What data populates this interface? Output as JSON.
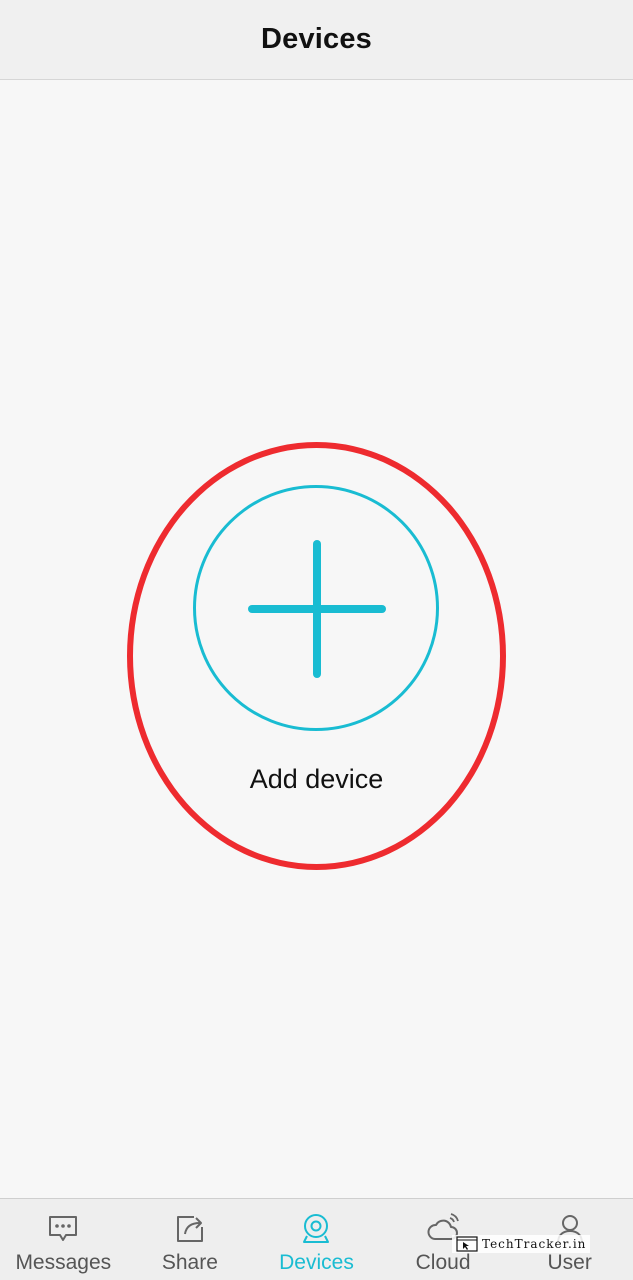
{
  "header": {
    "title": "Devices"
  },
  "main": {
    "add_device_label": "Add device",
    "add_icon": "plus-icon",
    "accent_color": "#19bcd2",
    "highlight_color": "#ee2b2f"
  },
  "tabbar": {
    "active": "Devices",
    "tabs": [
      {
        "label": "Messages",
        "icon": "message-icon"
      },
      {
        "label": "Share",
        "icon": "share-icon"
      },
      {
        "label": "Devices",
        "icon": "camera-icon"
      },
      {
        "label": "Cloud",
        "icon": "cloud-icon"
      },
      {
        "label": "User",
        "icon": "user-icon"
      }
    ]
  },
  "watermark": {
    "text": "TechTracker.in"
  }
}
